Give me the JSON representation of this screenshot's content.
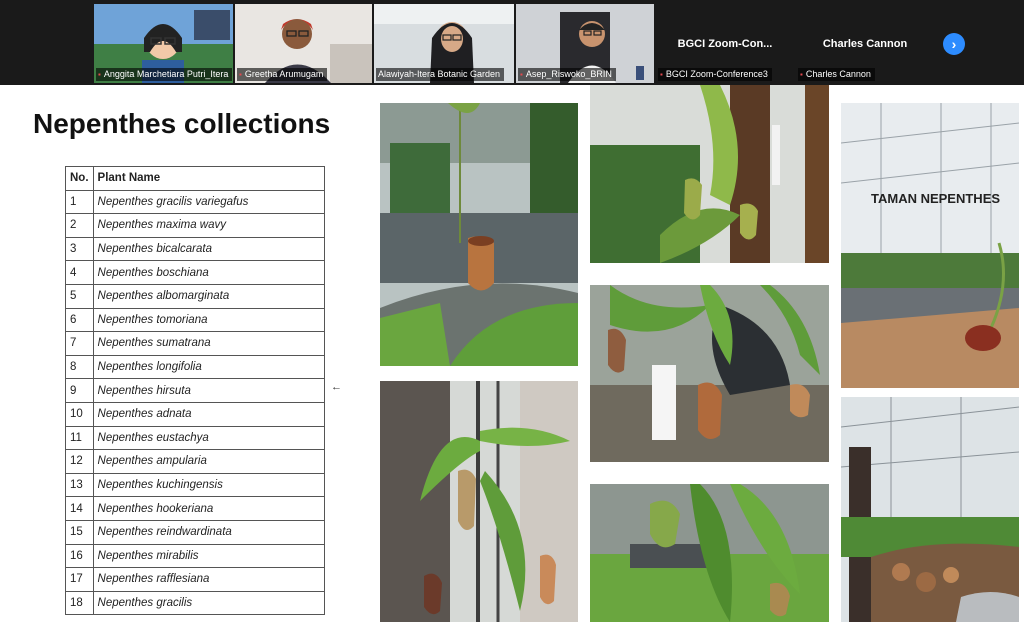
{
  "participants": [
    {
      "name": "Anggita Marchetiara Putri_Itera",
      "muted": true,
      "video": true
    },
    {
      "name": "Greetha Arumugam",
      "muted": true,
      "video": true
    },
    {
      "name": "Alawiyah-Itera Botanic Garden",
      "muted": false,
      "video": true,
      "speaking": true
    },
    {
      "name": "Asep_Riswoko_BRIN",
      "muted": true,
      "video": true
    },
    {
      "name": "BGCI Zoom-Conference3",
      "display": "BGCI  Zoom-Con...",
      "muted": true,
      "video": false
    },
    {
      "name": "Charles Cannon",
      "display": "Charles Cannon",
      "muted": true,
      "video": false
    }
  ],
  "icons": {
    "mic_off": "mic-off-icon",
    "next_page": "chevron-right-icon",
    "pointer": "arrow-left-icon"
  },
  "colors": {
    "accent": "#2d8cff",
    "active_speaker": "#23d160",
    "mic_off": "#e5484d"
  },
  "slide": {
    "title": "Nepenthes collections",
    "table": {
      "headers": [
        "No.",
        "Plant Name"
      ],
      "rows": [
        [
          "1",
          "Nepenthes gracilis variegafus"
        ],
        [
          "2",
          "Nepenthes maxima wavy"
        ],
        [
          "3",
          "Nepenthes bicalcarata"
        ],
        [
          "4",
          "Nepenthes boschiana"
        ],
        [
          "5",
          "Nepenthes albomarginata"
        ],
        [
          "6",
          "Nepenthes tomoriana"
        ],
        [
          "7",
          "Nepenthes sumatrana"
        ],
        [
          "8",
          "Nepenthes longifolia"
        ],
        [
          "9",
          "Nepenthes hirsuta"
        ],
        [
          "10",
          "Nepenthes adnata"
        ],
        [
          "11",
          "Nepenthes eustachya"
        ],
        [
          "12",
          "Nepenthes ampularia"
        ],
        [
          "13",
          "Nepenthes kuchingensis"
        ],
        [
          "14",
          "Nepenthes hookeriana"
        ],
        [
          "15",
          "Nepenthes reindwardinata"
        ],
        [
          "16",
          "Nepenthes mirabilis"
        ],
        [
          "17",
          "Nepenthes rafflesiana"
        ],
        [
          "18",
          "Nepenthes gracilis"
        ]
      ]
    },
    "photo_signage": "TAMAN NEPENTHES"
  }
}
